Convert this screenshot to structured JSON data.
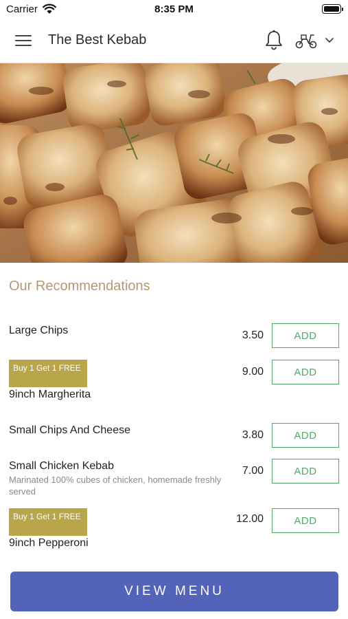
{
  "status_bar": {
    "carrier": "Carrier",
    "time": "8:35 PM",
    "icons": [
      "wifi-icon",
      "battery-icon"
    ]
  },
  "header": {
    "title": "The Best Kebab",
    "icons": [
      "hamburger-menu-icon",
      "bell-icon",
      "scooter-icon",
      "chevron-down-icon"
    ]
  },
  "hero": {
    "image": "grilled chicken kebab skewers"
  },
  "recommendations": {
    "title": "Our Recommendations",
    "items": [
      {
        "name": "Large Chips",
        "price": "3.50",
        "badge": "",
        "description": "",
        "add_label": "ADD"
      },
      {
        "name": "9inch Margherita",
        "price": "9.00",
        "badge": "Buy 1 Get 1 FREE",
        "description": "",
        "add_label": "ADD"
      },
      {
        "name": "Small Chips And Cheese",
        "price": "3.80",
        "badge": "",
        "description": "",
        "add_label": "ADD"
      },
      {
        "name": "Small Chicken Kebab",
        "price": "7.00",
        "badge": "",
        "description": "Marinated 100% cubes of chicken, homemade freshly served",
        "add_label": "ADD"
      },
      {
        "name": "9inch Pepperoni",
        "price": "12.00",
        "badge": "Buy 1 Get 1 FREE",
        "description": "",
        "add_label": "ADD"
      }
    ]
  },
  "footer": {
    "view_menu_label": "VIEW MENU"
  },
  "colors": {
    "accent_text": "#b09a72",
    "add_button": "#4faa6a",
    "badge": "#b9a64a",
    "view_menu_button": "#5363b8"
  }
}
